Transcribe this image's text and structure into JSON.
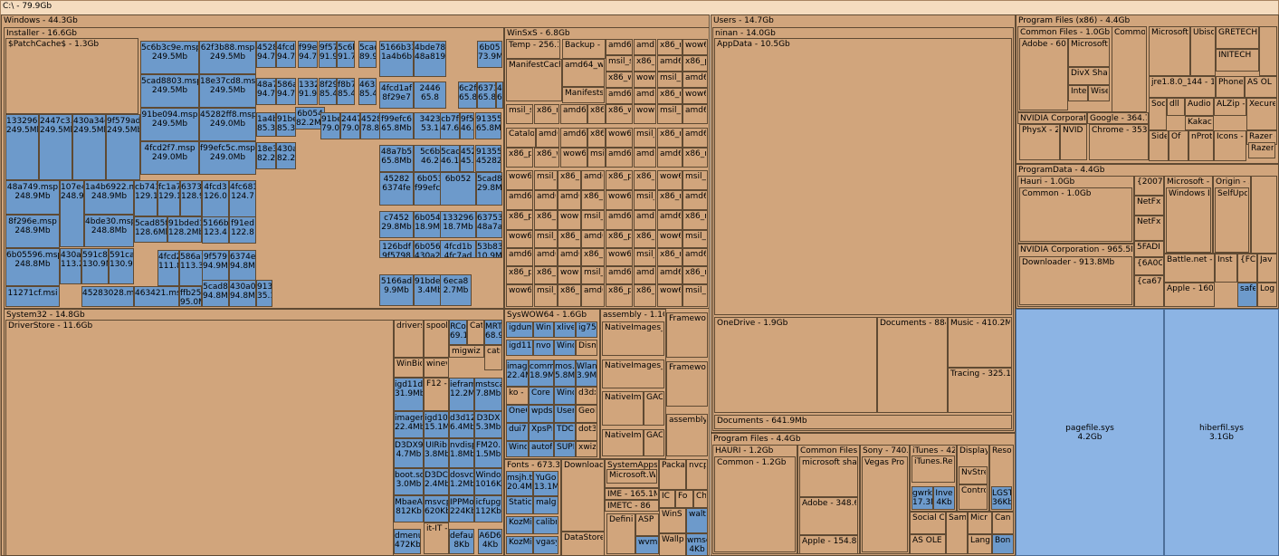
{
  "colors": {
    "folder": "#d1a57c",
    "file": "#6d9acb",
    "large_file": "#8cb4e4",
    "root": "#f5dcbf"
  },
  "root_label": "C:\\ - 79.9Gb",
  "windows": {
    "label": "Windows - 44.3Gb",
    "installer": {
      "label": "Installer - 16.6Gb",
      "patchcache": "$PatchCache$ - 1.3Gb",
      "msp": [
        [
          "5c6b3c9e.msp",
          "249.5Mb"
        ],
        [
          "62f3b88.msp",
          "249.5Mb"
        ],
        [
          "5cad8803.msp",
          "249.5Mb"
        ],
        [
          "18e37cd8.msp",
          "249.5Mb"
        ],
        [
          "91be094.msp",
          "249.5Mb"
        ],
        [
          "45282ff8.msp",
          "249.0Mb"
        ],
        [
          "4fcd2f7.msp",
          "249.0Mb"
        ],
        [
          "f99efc5c.msp",
          "249.0Mb"
        ],
        [
          "1332967",
          "249.5Mb"
        ],
        [
          "2447c3.",
          "249.5Mb"
        ],
        [
          "430a34c",
          "249.5Mb"
        ],
        [
          "9f579ad",
          "249.5Mb"
        ],
        [
          "48a749.msp",
          "248.9Mb"
        ],
        [
          "107e4",
          "248.9M"
        ],
        [
          "1a4b6922.ms",
          "248.9Mb"
        ],
        [
          "8f296e.msp",
          "248.9Mb"
        ],
        [
          "4bde30.msp",
          "248.8Mb"
        ],
        [
          "6b05596.msp",
          "248.8Mb"
        ],
        [
          "430a",
          "113.2M"
        ],
        [
          "591c8f",
          "130.9M"
        ],
        [
          "591ca9",
          "130.9M"
        ],
        [
          "11271cf.msi",
          ""
        ],
        [
          "45283028.msp",
          ""
        ],
        [
          "463421.msp",
          ""
        ],
        [
          "cb743",
          "129.1"
        ],
        [
          "fc1a7",
          "129.1"
        ],
        [
          "6373",
          "128.9"
        ],
        [
          "5cad85f",
          "128.6Mb"
        ],
        [
          "91bded1",
          "128.2Mb"
        ],
        [
          "586a1",
          "113.3"
        ],
        [
          "4fcd2",
          "111.8"
        ],
        [
          "4528",
          "94.7"
        ],
        [
          "4fcd2",
          "94.7"
        ],
        [
          "f99e",
          "94.7"
        ],
        [
          "9f57",
          "91.9"
        ],
        [
          "5c6b",
          "91.7"
        ],
        [
          "5cad",
          "89.9"
        ],
        [
          "48a7",
          "94.7"
        ],
        [
          "586a",
          "94.7"
        ],
        [
          "1332",
          "91.9"
        ],
        [
          "8f29",
          "85.4"
        ],
        [
          "f8b7",
          "85.4"
        ],
        [
          "4635",
          "85.4"
        ],
        [
          "1a4b",
          "85.3"
        ],
        [
          "91be",
          "85.3"
        ],
        [
          "6b054",
          "82.2Mb"
        ],
        [
          "18e3",
          "82.2"
        ],
        [
          "430a",
          "82.2"
        ],
        [
          "91be",
          "79.0"
        ],
        [
          "2447",
          "79.0"
        ],
        [
          "4528",
          "78.8"
        ],
        [
          "4fcd3",
          "126.0"
        ],
        [
          "4fc681",
          "124.7"
        ],
        [
          "5166b",
          "123.4"
        ],
        [
          "f91ed",
          "122.8"
        ],
        [
          "9f579",
          "94.9Mb"
        ],
        [
          "6374e",
          "94.8Mb"
        ],
        [
          "ffb25b",
          "95.0Mb"
        ],
        [
          "5cad8",
          "94.8Mb"
        ],
        [
          "430a0",
          "94.8Mb"
        ],
        [
          "9135",
          "35.1"
        ],
        [
          "5166b33",
          "1a4b6b"
        ],
        [
          "4bde78",
          "48a819"
        ],
        [
          "6b05",
          "73.9M"
        ],
        [
          "4fcd1af",
          "8f29e7"
        ],
        [
          "2446",
          "65.8"
        ],
        [
          "6c2f",
          "65.8"
        ],
        [
          "6373",
          "65.8"
        ],
        [
          "430a0cd",
          "65.8Mb"
        ],
        [
          "f99efc6",
          "65.8Mb"
        ],
        [
          "3423",
          "53.1"
        ],
        [
          "cb7f",
          "47.6"
        ],
        [
          "9f57",
          "46.2"
        ],
        [
          "91355d",
          "65.8Mb"
        ],
        [
          "48a7b5",
          "65.8Mb"
        ],
        [
          "5c6b",
          "46.2"
        ],
        [
          "5cad",
          "46.1"
        ],
        [
          "4528",
          "45.9"
        ],
        [
          "91355cb",
          "45282ee"
        ],
        [
          "45282",
          "6374fe"
        ],
        [
          "6b053",
          "f99efcb"
        ],
        [
          "6b052"
        ],
        [
          "5cad88",
          "29.8Mb"
        ],
        [
          "c7452",
          "29.8Mb"
        ],
        [
          "6b0548",
          "18.9Mb"
        ],
        [
          "133296",
          "18.7Mb"
        ],
        [
          "637537",
          "48a7ad"
        ],
        [
          "126bdf",
          "9f5798"
        ],
        [
          "6b0567",
          "430a2d"
        ],
        [
          "4fcd1b",
          "4fc7ad"
        ],
        [
          "53b838",
          "10.9Mb"
        ],
        [
          "5166ad",
          "9.9Mb"
        ],
        [
          "91bde9",
          "3.4Mb"
        ],
        [
          "6eca8",
          "2.7Mb"
        ]
      ]
    },
    "winsxs": {
      "label": "WinSxS - 6.8Gb",
      "temp": "Temp - 256.1M",
      "backup": "Backup - 1",
      "manifestcache": "ManifestCache",
      "manifests": "Manifests -",
      "catalogs": "Catalog",
      "amd64_wi": "amd64_wi",
      "items": [
        "amd64",
        "amd6",
        "x86_m",
        "wow6",
        "msil_s",
        "x86_n",
        "amd64_n",
        "x86_p",
        "x86_w",
        "wow64",
        "msil_n",
        "amd6_"
      ]
    },
    "system32": {
      "label": "System32 - 14.8Gb",
      "driverstore": "DriverStore - 11.6Gb",
      "items": [
        [
          "drivers",
          ""
        ],
        [
          "spool",
          ""
        ],
        [
          "RCo",
          "69.1"
        ],
        [
          "Cat",
          ""
        ],
        [
          "MRT",
          "68.9"
        ],
        [
          "migwiz",
          ""
        ],
        [
          "catro",
          ""
        ],
        [
          "WinBio",
          ""
        ],
        [
          "winevt",
          ""
        ],
        [
          "igd11dx",
          "31.9Mb"
        ],
        [
          "F12 -",
          ""
        ],
        [
          "ieframe",
          "12.2M"
        ],
        [
          "mstsca",
          "7.8Mb"
        ],
        [
          "imagers",
          "22.4Mb"
        ],
        [
          "igd10",
          "15.1M"
        ],
        [
          "d3d12",
          "6.4Mb"
        ],
        [
          "D3DX",
          "5.3Mb"
        ],
        [
          "D3DX9",
          "4.7Mb"
        ],
        [
          "UIRib",
          "3.8Mb"
        ],
        [
          "nvdisp",
          "1.8Mb"
        ],
        [
          "FM20.",
          "1.5Mb"
        ],
        [
          "boot.sd",
          "3.0Mb"
        ],
        [
          "D3DC",
          "2.4Mb"
        ],
        [
          "dosvc.",
          "1.2Mb"
        ],
        [
          "Windo",
          "1016K"
        ],
        [
          "MbaeA",
          "812Kb"
        ],
        [
          "msvcp",
          "620Kb"
        ],
        [
          "IPPMo",
          "224Kb"
        ],
        [
          "icfupg",
          "112Kb"
        ],
        [
          "dmenu",
          "472Kb"
        ],
        [
          "it-IT -",
          ""
        ],
        [
          "default",
          "8Kb"
        ],
        [
          "A6D6",
          "4Kb"
        ]
      ]
    },
    "syswow64": {
      "label": "SysWOW64 - 1.6Gb",
      "items": [
        [
          "igdumd",
          ""
        ],
        [
          "Win",
          ""
        ],
        [
          "xlive.",
          ""
        ],
        [
          "ig75iv",
          ""
        ],
        [
          "igd11dx",
          ""
        ],
        [
          "nvo",
          ""
        ],
        [
          "Windo",
          ""
        ],
        [
          "Dism",
          ""
        ],
        [
          "image",
          "22.4M"
        ],
        [
          "comm",
          "18.9M"
        ],
        [
          "mos.d",
          "5.8M"
        ],
        [
          "Wlan",
          "3.9M"
        ],
        [
          "ko - 3",
          ""
        ],
        [
          "Core",
          ""
        ],
        [
          "Windo",
          ""
        ],
        [
          "d3dx1",
          ""
        ],
        [
          "OneC",
          ""
        ],
        [
          "wpds",
          ""
        ],
        [
          "UserL",
          ""
        ],
        [
          "Geolo",
          ""
        ],
        [
          "dui70",
          ""
        ],
        [
          "XpsPr",
          ""
        ],
        [
          "TDCa",
          ""
        ],
        [
          "dot3n",
          ""
        ],
        [
          "Windo",
          ""
        ],
        [
          "autof",
          ""
        ],
        [
          "SUPE",
          ""
        ],
        [
          "xwiza",
          ""
        ]
      ]
    },
    "assembly": {
      "label": "assembly - 1.1Gb",
      "native1": "NativeImages_",
      "native2": "NativeImages_",
      "native3": "NativeImag",
      "native4": "NativeIma",
      "gac1": "GAC",
      "gac2": "GAC",
      "framework1": "Framewo",
      "framework2": "Framewo",
      "assembly_sub": "assembly"
    },
    "fonts": {
      "label": "Fonts - 673.3M",
      "items": [
        [
          "msjh.tt",
          "20.4M"
        ],
        [
          "YuGo",
          "13.1M"
        ],
        [
          "Static",
          ""
        ],
        [
          "malgu",
          ""
        ],
        [
          "KozMi",
          ""
        ],
        [
          "calibri",
          ""
        ],
        [
          "KozMi",
          ""
        ],
        [
          "vgasy",
          ""
        ]
      ]
    },
    "download": "Download",
    "datastore": "DataStore",
    "systemapps": {
      "label": "SystemApps",
      "ms_wi": "Microsoft.Wi"
    },
    "ime": "IME - 165.1M",
    "imetc": "IMETC - 86",
    "defin": "Defini",
    "asp": "ASP",
    "packa": "Packa",
    "nvcp": "nvcp",
    "ic": "IC",
    "fo": "Fo",
    "ch": "Ch",
    "winsa": "WinS",
    "walt": "walt",
    "wvm": "wvm",
    "wallp": "Wallp",
    "wmse": "wmse",
    "wmse_size": "4Kb"
  },
  "users": {
    "label": "Users - 14.7Gb",
    "ninan": "ninan - 14.0Gb",
    "appdata": "AppData - 10.5Gb",
    "onedrive": "OneDrive - 1.9Gb",
    "documents": "Documents - 884.3",
    "music": "Music - 410.2Mb",
    "tracing": "Tracing - 325.1M",
    "documents2": "Documents - 641.9Mb"
  },
  "program_files_x86": {
    "label": "Program Files (x86) - 4.4Gb",
    "common": "Common Files - 1.0Gb",
    "adobe": "Adobe - 601",
    "microsoft": "Microsoft",
    "commo": "Commo",
    "microsoft2": "Microsoft",
    "ubiso": "Ubiso",
    "gretech": "GRETECH",
    "inittech": "INITECH",
    "divx": "DivX Shar",
    "intel": "Intel",
    "wise": "Wise",
    "jre": "jre1.8.0_144 - 16",
    "phone": "Phone",
    "asol": "AS OL",
    "soc": "Soc",
    "dll": "dll",
    "audio": "Audio",
    "alzip": "ALZip -",
    "xecure": "Xecure",
    "kakao": "Kakac",
    "nvidia": "NVIDIA Corporat",
    "google": "Google - 364.7",
    "physx": "PhysX - 2(",
    "nvid": "NVID",
    "chrome": "Chrome - 353.",
    "side": "Side",
    "of": "Of",
    "nprot": "nProt",
    "icons": "Icons -",
    "razer": "Razer -",
    "razer2": "Razer"
  },
  "programdata": {
    "label": "ProgramData - 4.4Gb",
    "hauri": "Hauri - 1.0Gb",
    "common": "Common - 1.0Gb",
    "k2007": "{2007",
    "netfx1": "NetFx",
    "netfx2": "NetFx",
    "fadi": "5FADI",
    "a6a0c": "{6A0C",
    "ca675": "{ca675",
    "microsoft": "Microsoft - 5",
    "windows_d": "Windows D",
    "origin": "Origin - 3",
    "selfupd": "SelfUpd",
    "nvidia": "NVIDIA Corporation - 965.5M",
    "downloader": "Downloader - 913.8Mb",
    "battlenet": "Battle.net -",
    "inst": "Inst",
    "fc": "{FC",
    "jav": "Jav",
    "apple": "Apple - 160.",
    "safe": "safe",
    "log": "Log"
  },
  "program_files": {
    "label": "Program Files - 4.4Gb",
    "hauri": "HAURI - 1.2Gb",
    "common": "Common - 1.2Gb",
    "commonfiles": "Common Files -",
    "mshare": "microsoft share",
    "adobe": "Adobe - 348.6",
    "apple": "Apple - 154.8M",
    "sony": "Sony - 740.",
    "vegas": "Vegas Pro",
    "itunes": "iTunes - 42",
    "itunesres": "iTunes.Res",
    "gwrk": "gwrk",
    "gwrk_size": "17.3M",
    "inve": "Inve",
    "inve_size": "4Kb",
    "display": "Display",
    "nvstre": "NvStre",
    "control": "Control",
    "reso": "Reso",
    "lgst": "LGST",
    "lgst_size": "36Kb",
    "social": "Social C",
    "sam": "Sam",
    "micr": "Micr",
    "can": "Can",
    "asole": "AS OLE",
    "lang": "Lang",
    "bon": "Bon"
  },
  "pagefile": {
    "name": "pagefile.sys",
    "size": "4.2Gb"
  },
  "hiberfil": {
    "name": "hiberfil.sys",
    "size": "3.1Gb"
  }
}
